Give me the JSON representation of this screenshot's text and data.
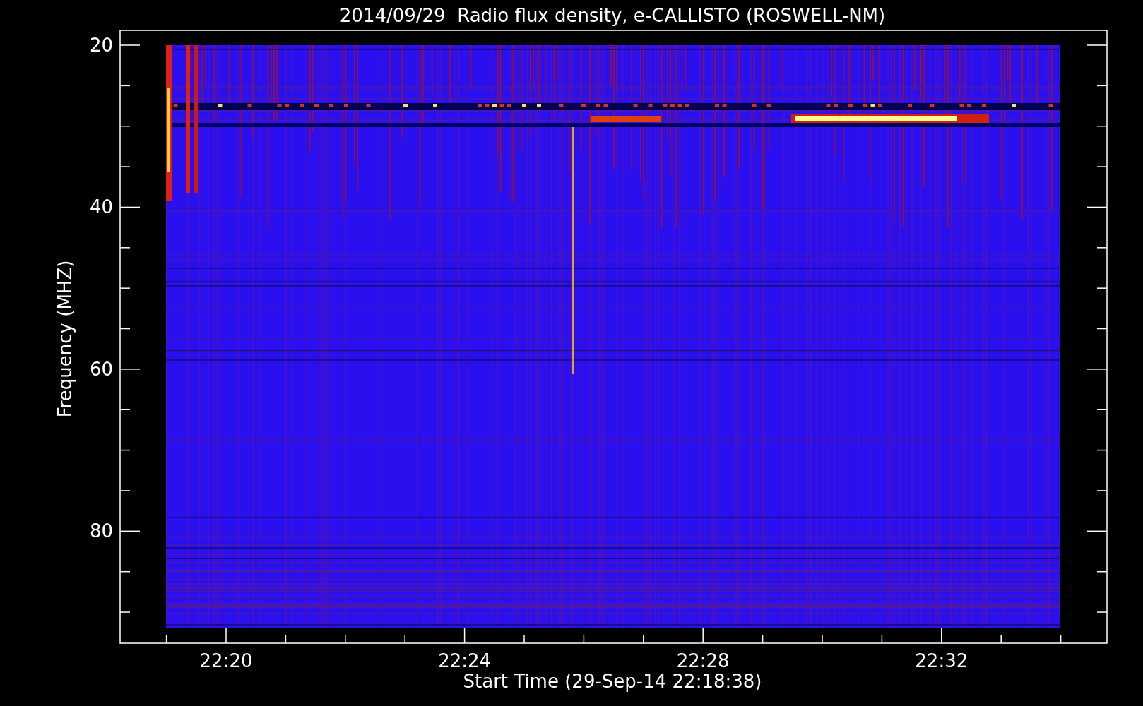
{
  "plot": {
    "title": "2014/09/29  Radio flux density, e-CALLISTO (ROSWELL-NM)",
    "y_axis": {
      "label": "Frequency (MHZ)",
      "ticks": [
        "20",
        "40",
        "60",
        "80"
      ]
    },
    "x_axis": {
      "label": "Start Time (29-Sep-14 22:18:38)",
      "ticks": [
        "22:20",
        "22:24",
        "22:28",
        "22:32"
      ]
    }
  }
}
